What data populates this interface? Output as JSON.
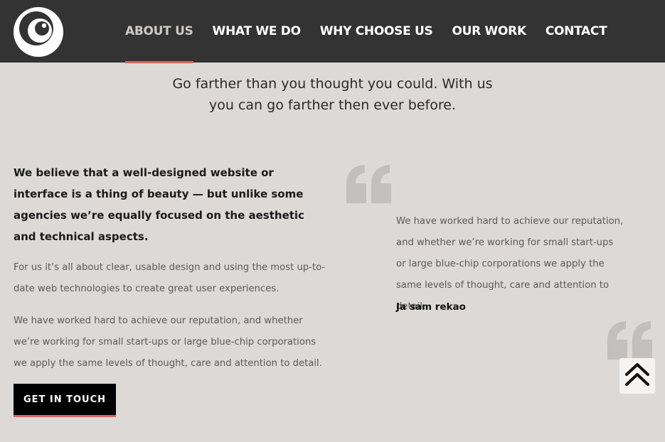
{
  "header": {
    "logo_icon": "swirl-logo-icon",
    "nav": [
      {
        "label": "ABOUT US",
        "active": true
      },
      {
        "label": "WHAT WE DO",
        "active": false
      },
      {
        "label": "WHY CHOOSE US",
        "active": false
      },
      {
        "label": "OUR WORK",
        "active": false
      },
      {
        "label": "CONTACT",
        "active": false
      }
    ]
  },
  "intro": {
    "line1": "Go farther than you thought you could. With us",
    "line2": "you can go farther then ever before."
  },
  "about": {
    "lead": "We believe that a well-designed website or interface is a thing of beauty — but unlike some agencies we’re equally focused on the aesthetic and technical aspects.",
    "paragraph1": "For us it’s all about clear, usable design and using the most up-to-date web technologies to create great user experiences.",
    "paragraph2": "We have worked hard to achieve our reputation, and whether we’re working for small start-ups or large blue-chip corporations we apply the same levels of thought, care and attention to detail.",
    "cta_label": "GET IN TOUCH"
  },
  "testimonial": {
    "quote": "We have worked hard to achieve our reputation, and whether we’re working for small start-ups or large blue-chip corporations we apply the same levels of thought, care and attention to detail.",
    "author": "Ja sam rekao"
  },
  "icons": {
    "quote_open": "open-quote-icon",
    "quote_close": "close-quote-icon",
    "scroll_top": "double-chevron-up-icon"
  },
  "colors": {
    "header_bg": "#333333",
    "page_bg": "#dcd9d6",
    "accent": "#e0625e",
    "quote_mark": "#c3bfbc"
  }
}
